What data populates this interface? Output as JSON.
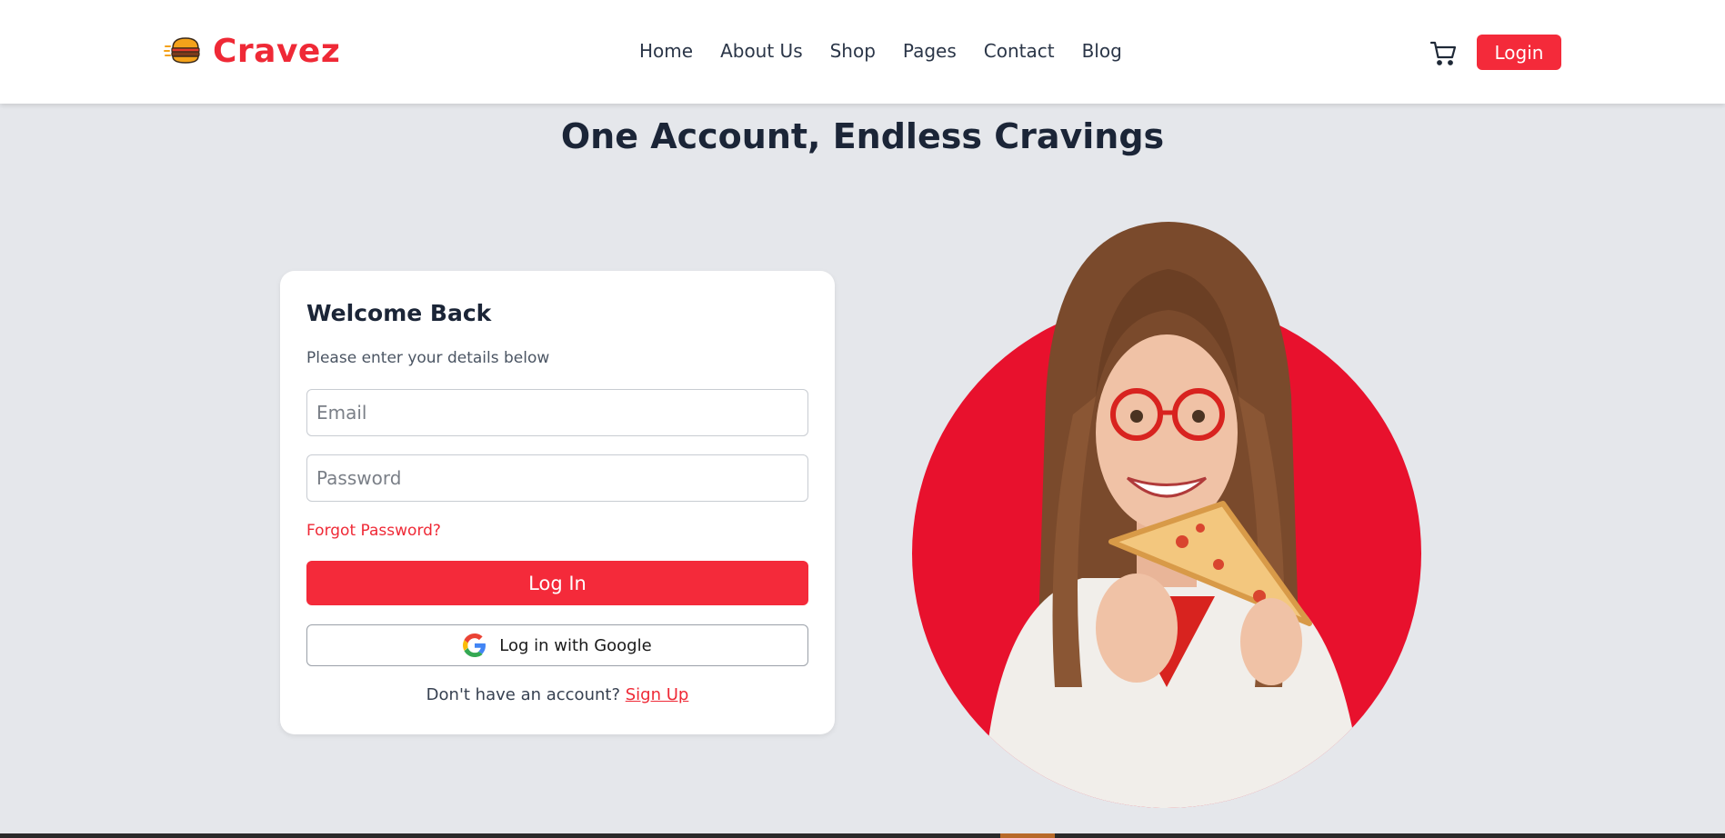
{
  "brand": {
    "name": "Cravez",
    "accent": "#f42a3a"
  },
  "nav": {
    "items": [
      {
        "label": "Home"
      },
      {
        "label": "About Us"
      },
      {
        "label": "Shop"
      },
      {
        "label": "Pages"
      },
      {
        "label": "Contact"
      },
      {
        "label": "Blog"
      }
    ],
    "cart_icon": "cart-icon",
    "login_label": "Login"
  },
  "hero": {
    "title": "One Account, Endless Cravings"
  },
  "login_card": {
    "title": "Welcome Back",
    "subtitle": "Please enter your details below",
    "email_placeholder": "Email",
    "password_placeholder": "Password",
    "forgot_label": "Forgot Password?",
    "submit_label": "Log In",
    "google_label": "Log in with Google",
    "signup_prompt": "Don't have an account?",
    "signup_link": "Sign Up"
  }
}
